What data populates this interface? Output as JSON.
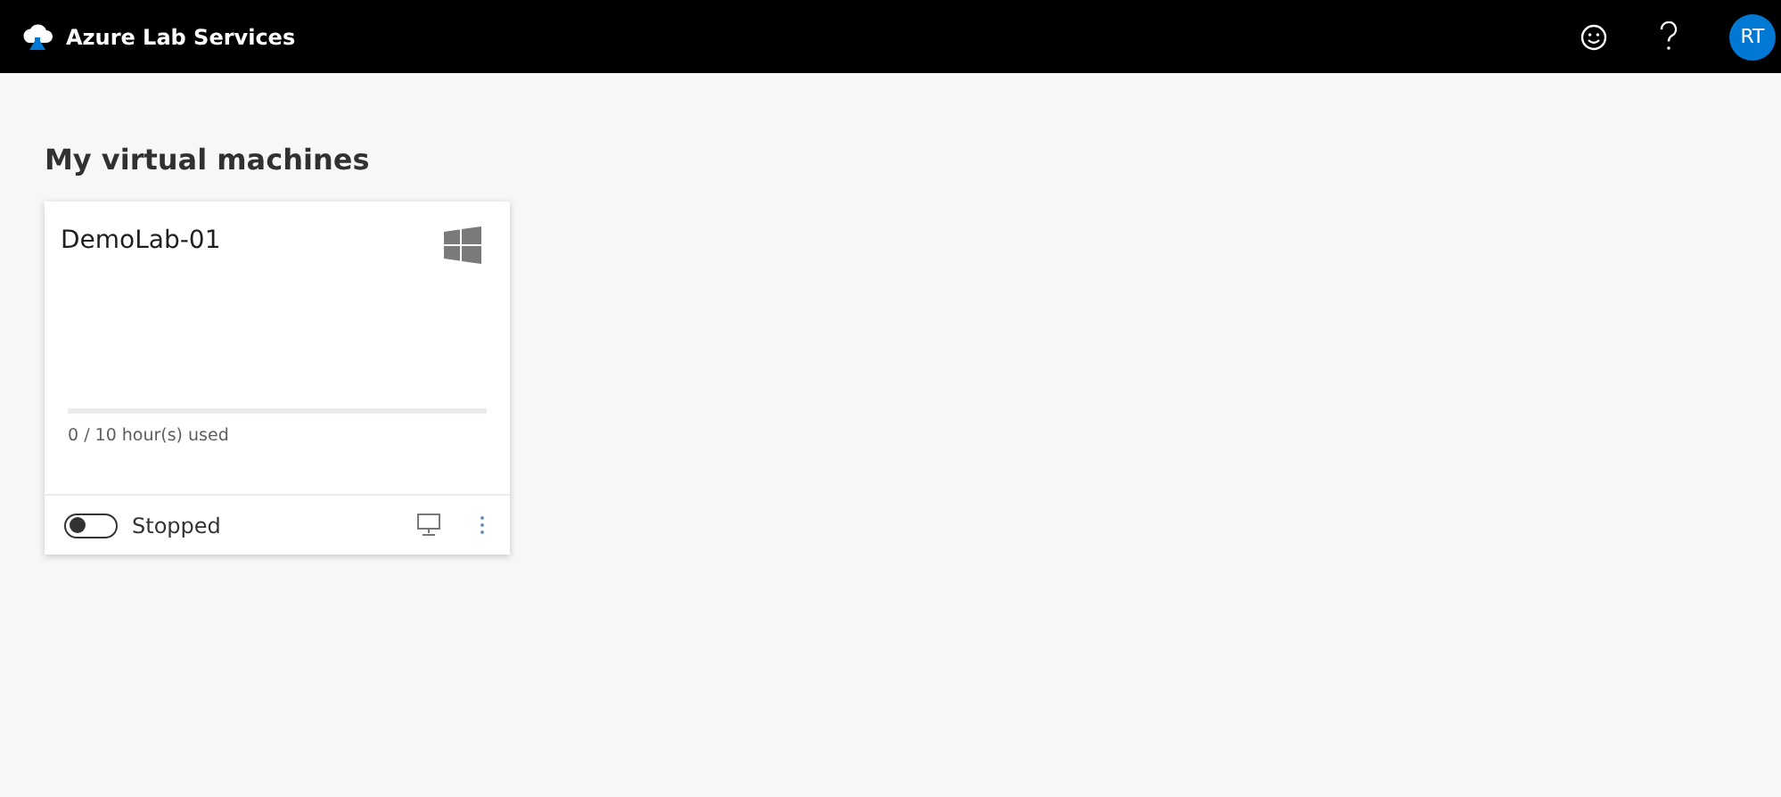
{
  "header": {
    "title": "Azure Lab Services",
    "avatar": "RT"
  },
  "page": {
    "title": "My virtual machines"
  },
  "machines": [
    {
      "name": "DemoLab-01",
      "level": 0,
      "usage": "0 / 10 hour(s) used",
      "on": false,
      "status": "Stopped"
    }
  ]
}
